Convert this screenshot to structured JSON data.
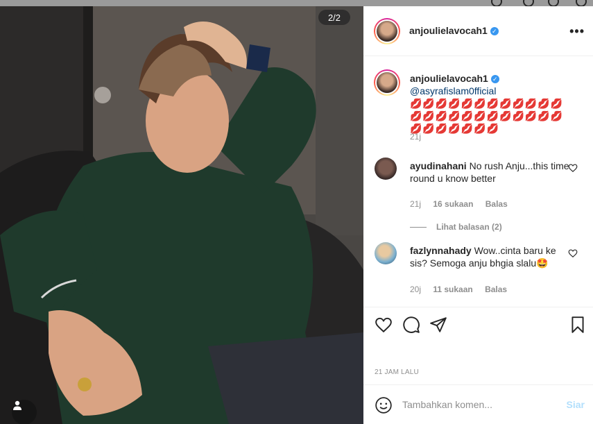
{
  "photo": {
    "counter": "2/2",
    "user_tag_icon": "person-icon"
  },
  "post": {
    "username": "anjoulielavocah1",
    "more_icon": "more-options-icon",
    "caption_mention": "@asyrafislam0fficial",
    "caption_emojis": "💋💋💋💋💋💋💋💋💋💋💋💋💋💋💋💋💋💋💋💋💋💋💋💋💋💋💋💋💋💋💋",
    "caption_time": "21j"
  },
  "comments": [
    {
      "username": "ayudinahani",
      "text": "No rush Anju...this time round u know better",
      "time": "21j",
      "likes": "16 sukaan",
      "reply": "Balas",
      "view_replies": "Lihat balasan (2)"
    },
    {
      "username": "fazlynnahady",
      "text": "Wow..cinta baru ke sis? Semoga anju bhgia slalu🤩",
      "time": "20j",
      "likes": "11 sukaan",
      "reply": "Balas"
    }
  ],
  "actions": {
    "like_icon": "heart-icon",
    "comment_icon": "comment-icon",
    "share_icon": "share-icon",
    "save_icon": "bookmark-icon"
  },
  "timestamp": "21 JAM LALU",
  "add_comment": {
    "placeholder": "Tambahkan komen...",
    "post_label": "Siar"
  },
  "colors": {
    "link": "#00376b",
    "verified": "#3897f0",
    "muted": "#8e8e8e",
    "post_disabled": "#b2dffc"
  }
}
